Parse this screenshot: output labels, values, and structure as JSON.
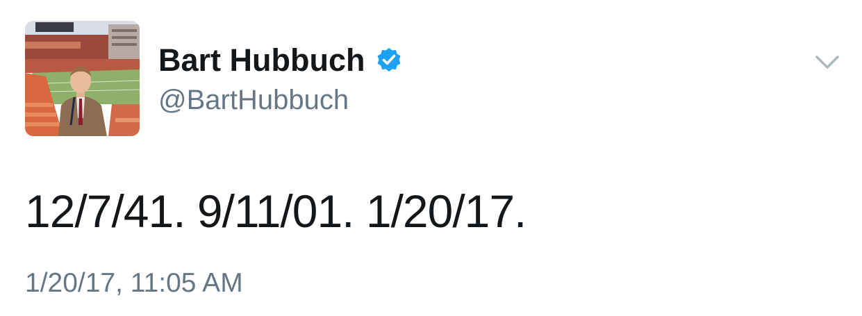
{
  "author": {
    "display_name": "Bart Hubbuch",
    "handle": "@BartHubbuch",
    "verified": true,
    "avatar_icon": "avatar-photo-stadium"
  },
  "tweet": {
    "text": "12/7/41. 9/11/01. 1/20/17.",
    "timestamp": "1/20/17, 11:05 AM"
  },
  "icons": {
    "verified": "verified-badge-icon",
    "menu": "chevron-down-icon"
  },
  "colors": {
    "verified_blue": "#1da1f2",
    "text_primary": "#14171a",
    "text_secondary": "#657786",
    "caret_gray": "#aab8c2"
  }
}
